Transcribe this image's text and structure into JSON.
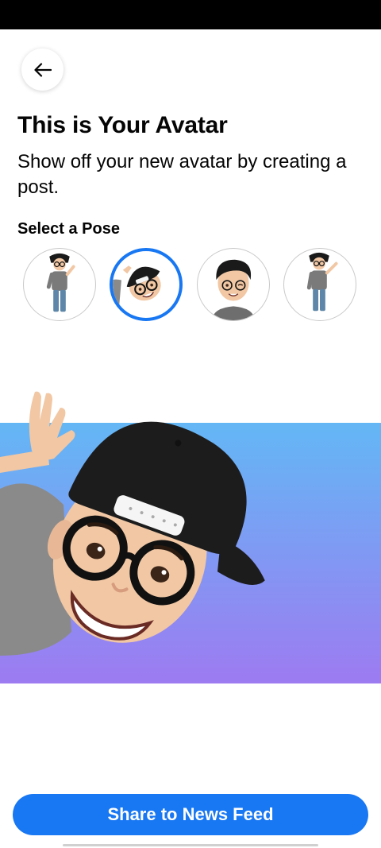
{
  "header": {
    "title": "This is Your Avatar",
    "subtitle": "Show off your new avatar by creating a post."
  },
  "poses": {
    "label": "Select a Pose",
    "selected_index": 1,
    "items": [
      {
        "icon": "avatar-standing-thumbs-up-icon"
      },
      {
        "icon": "avatar-peeking-wave-icon"
      },
      {
        "icon": "avatar-face-wink-icon"
      },
      {
        "icon": "avatar-standing-wave-icon"
      }
    ]
  },
  "preview": {
    "icon": "avatar-peeking-wave-preview",
    "gradient": [
      "#63b7f5",
      "#9d7bf1"
    ]
  },
  "footer": {
    "share_label": "Share to News Feed"
  },
  "colors": {
    "accent": "#1877f2",
    "text": "#050505"
  }
}
